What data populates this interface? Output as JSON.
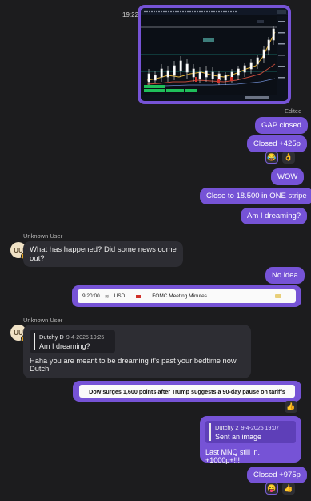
{
  "messages": {
    "chart": {
      "time": "19:22",
      "edited": "Edited"
    },
    "gap_closed": "GAP closed",
    "closed_425": "Closed +425p",
    "wow": "WOW",
    "close_18500": "Close to 18.500 in ONE stripe",
    "dreaming": "Am I dreaming?",
    "news": {
      "sender": "Unknown User",
      "avatar": "UU",
      "text": "What has happened? Did some news come out?"
    },
    "no_idea": "No idea",
    "calendar": {
      "time": "9:20:00",
      "currency": "USD",
      "event": "FOMC Meeting Minutes"
    },
    "reply_dutch": {
      "sender": "Unknown User",
      "avatar": "UU",
      "quote_name": "Dutchy D",
      "quote_date": "9-4-2025 19:25",
      "quote_text": "Am I dreaming?",
      "text": "Haha you are meant to be dreaming it's past your bedtime now Dutch"
    },
    "headline": "Dow surges 1,600 points after Trump suggests a 90-day pause on tariffs",
    "reply_mnq": {
      "quote_name": "Dutchy 2",
      "quote_date": "9-4-2025 19:07",
      "quote_text": "Sent an image",
      "text": "Last MNQ still in. +1000p+!!!"
    },
    "closed_975": "Closed +975p"
  },
  "reactions": {
    "after_closed_425": [
      "😂",
      "👌"
    ],
    "after_headline": [
      "👍"
    ],
    "after_closed_975": [
      "😝",
      "👍"
    ]
  },
  "colors": {
    "accent": "#7653d6",
    "incoming": "#2d2d33",
    "background": "#1c1c1e"
  }
}
